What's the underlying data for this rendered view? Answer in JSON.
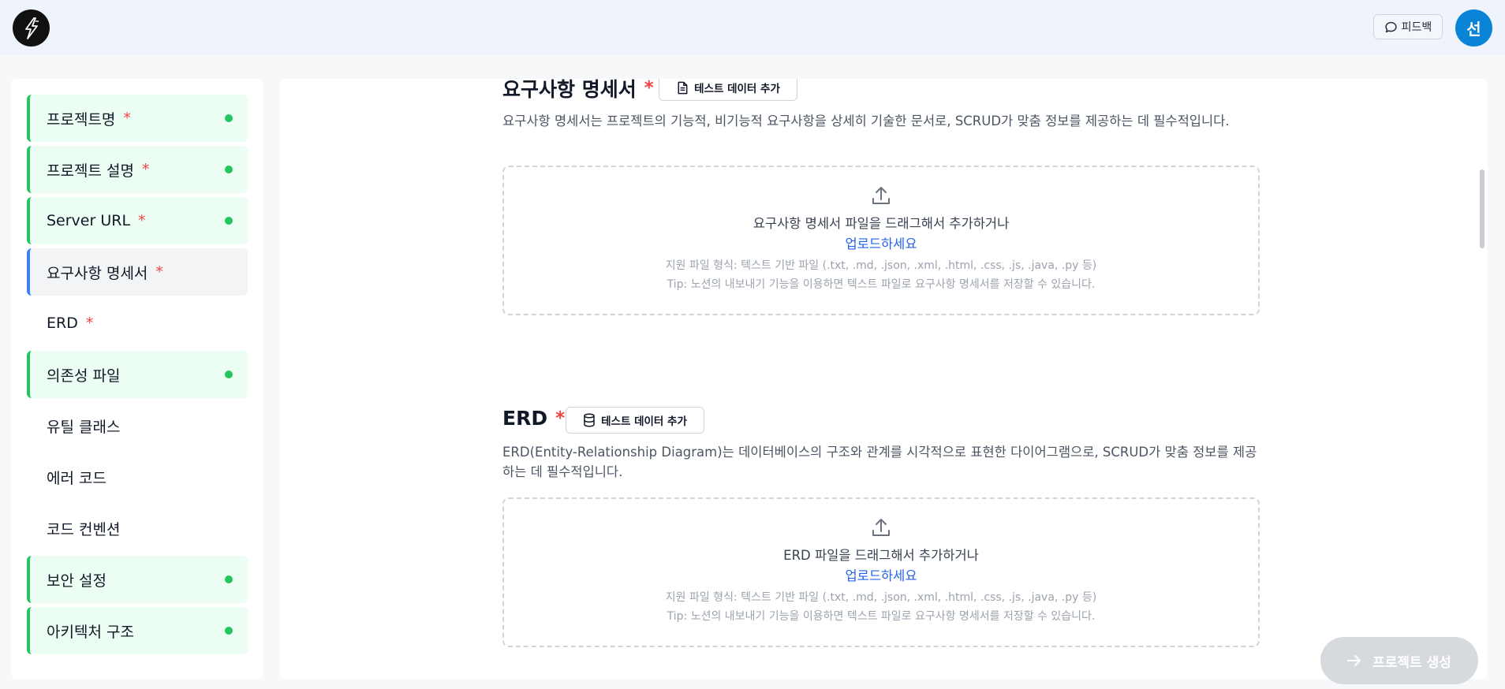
{
  "header": {
    "feedback_label": "피드백",
    "avatar_initial": "선"
  },
  "sidebar": {
    "items": [
      {
        "label": "프로젝트명",
        "required": "*",
        "status": "done"
      },
      {
        "label": "프로젝트 설명",
        "required": "*",
        "status": "done"
      },
      {
        "label": "Server URL",
        "required": "*",
        "status": "done"
      },
      {
        "label": "요구사항 명세서",
        "required": "*",
        "status": "active"
      },
      {
        "label": "ERD",
        "required": "*",
        "status": "empty"
      },
      {
        "label": "의존성 파일",
        "required": "",
        "status": "done"
      },
      {
        "label": "유틸 클래스",
        "required": "",
        "status": "empty"
      },
      {
        "label": "에러 코드",
        "required": "",
        "status": "empty"
      },
      {
        "label": "코드 컨벤션",
        "required": "",
        "status": "empty"
      },
      {
        "label": "보안 설정",
        "required": "",
        "status": "done"
      },
      {
        "label": "아키텍처 구조",
        "required": "",
        "status": "done"
      }
    ]
  },
  "sections": {
    "requirements": {
      "title": "요구사항 명세서",
      "required": "*",
      "test_button": "테스트 데이터 추가",
      "description": "요구사항 명세서는 프로젝트의 기능적, 비기능적 요구사항을 상세히 기술한 문서로, SCRUD가 맞춤 정보를 제공하는 데 필수적입니다.",
      "drop_text": "요구사항 명세서 파일을 드래그해서 추가하거나",
      "upload_link": "업로드하세요",
      "formats": "지원 파일 형식: 텍스트 기반 파일 (.txt, .md, .json, .xml, .html, .css, .js, .java, .py 등)",
      "tip": "Tip: 노션의 내보내기 기능을 이용하면 텍스트 파일로 요구사항 명세서를 저장할 수 있습니다."
    },
    "erd": {
      "title": "ERD",
      "required": "*",
      "test_button": "테스트 데이터 추가",
      "description": "ERD(Entity-Relationship Diagram)는 데이터베이스의 구조와 관계를 시각적으로 표현한 다이어그램으로, SCRUD가 맞춤 정보를 제공하는 데 필수적입니다.",
      "drop_text": "ERD 파일을 드래그해서 추가하거나",
      "upload_link": "업로드하세요",
      "formats": "지원 파일 형식: 텍스트 기반 파일 (.txt, .md, .json, .xml, .html, .css, .js, .java, .py 등)",
      "tip": "Tip: 노션의 내보내기 기능을 이용하면 텍스트 파일로 요구사항 명세서를 저장할 수 있습니다."
    }
  },
  "create_button": {
    "label": "프로젝트 생성"
  },
  "colors": {
    "done_accent": "#22c55e",
    "active_accent": "#3b82f6",
    "required": "#ef4444",
    "link": "#2563eb",
    "avatar": "#0a84d6"
  }
}
